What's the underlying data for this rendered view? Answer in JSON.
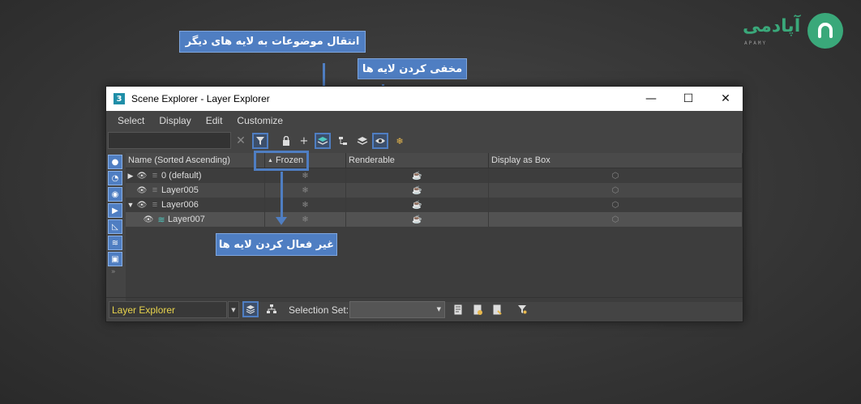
{
  "logo": {
    "text": "آپادمی",
    "sub": "APAMY"
  },
  "annotations": {
    "move_objects": "انتقال موضوعات به لایه های دیگر",
    "hide_layers": "مخفی کردن لایه ها",
    "freeze_layers": "غیر فعال کردن لایه ها"
  },
  "window": {
    "title": "Scene Explorer - Layer Explorer",
    "minimize": "—",
    "maximize": "☐",
    "close": "✕"
  },
  "menu": [
    "Select",
    "Display",
    "Edit",
    "Customize"
  ],
  "columns": {
    "name": "Name (Sorted Ascending)",
    "frozen": "Frozen",
    "renderable": "Renderable",
    "display_box": "Display as Box"
  },
  "rows": [
    {
      "name": "0 (default)"
    },
    {
      "name": "Layer005"
    },
    {
      "name": "Layer006"
    },
    {
      "name": "Layer007"
    }
  ],
  "status": {
    "explorer_combo": "Layer Explorer",
    "selection_set_label": "Selection Set:"
  },
  "colors": {
    "accent": "#4f7ec2",
    "logo": "#3aa87a",
    "combo_text": "#e8d44d"
  }
}
